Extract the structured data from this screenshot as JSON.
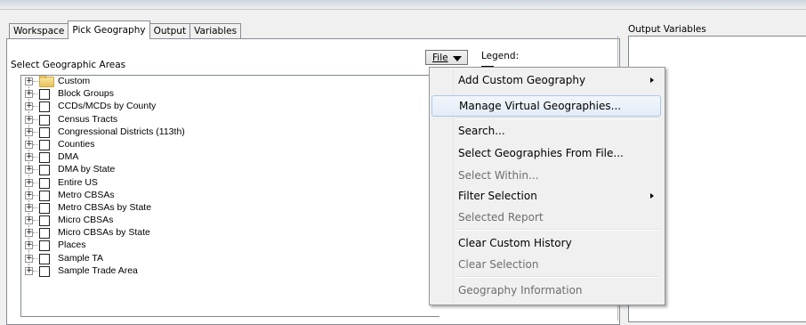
{
  "tabs": [
    {
      "label": "Workspace",
      "active": false
    },
    {
      "label": "Pick Geography",
      "active": true
    },
    {
      "label": "Output",
      "active": false
    },
    {
      "label": "Variables",
      "active": false
    }
  ],
  "select_label": "Select Geographic Areas",
  "file_button": {
    "label": "File"
  },
  "legend": {
    "label": "Legend:"
  },
  "output_label": "Output Variables",
  "tree": [
    {
      "label": "Custom",
      "icon": "folder-icon"
    },
    {
      "label": "Block Groups"
    },
    {
      "label": "CCDs/MCDs by County"
    },
    {
      "label": "Census Tracts"
    },
    {
      "label": "Congressional Districts (113th)"
    },
    {
      "label": "Counties"
    },
    {
      "label": "DMA"
    },
    {
      "label": "DMA by State"
    },
    {
      "label": "Entire US"
    },
    {
      "label": "Metro CBSAs"
    },
    {
      "label": "Metro CBSAs by State"
    },
    {
      "label": "Micro CBSAs"
    },
    {
      "label": "Micro CBSAs by State"
    },
    {
      "label": "Places"
    },
    {
      "label": "Sample TA"
    },
    {
      "label": "Sample Trade Area"
    }
  ],
  "menu": [
    {
      "label": "Add Custom Geography",
      "submenu": true,
      "enabled": true
    },
    {
      "label": "Manage Virtual Geographies...",
      "enabled": true,
      "highlighted": true
    },
    {
      "label": "Search...",
      "enabled": true
    },
    {
      "label": "Select Geographies From File...",
      "enabled": true
    },
    {
      "label": "Select Within...",
      "enabled": false
    },
    {
      "label": "Filter Selection",
      "submenu": true,
      "enabled": true
    },
    {
      "label": "Selected Report",
      "enabled": false
    },
    {
      "label": "Clear Custom History",
      "enabled": true
    },
    {
      "label": "Clear Selection",
      "enabled": false
    },
    {
      "label": "Geography Information",
      "enabled": false
    }
  ]
}
